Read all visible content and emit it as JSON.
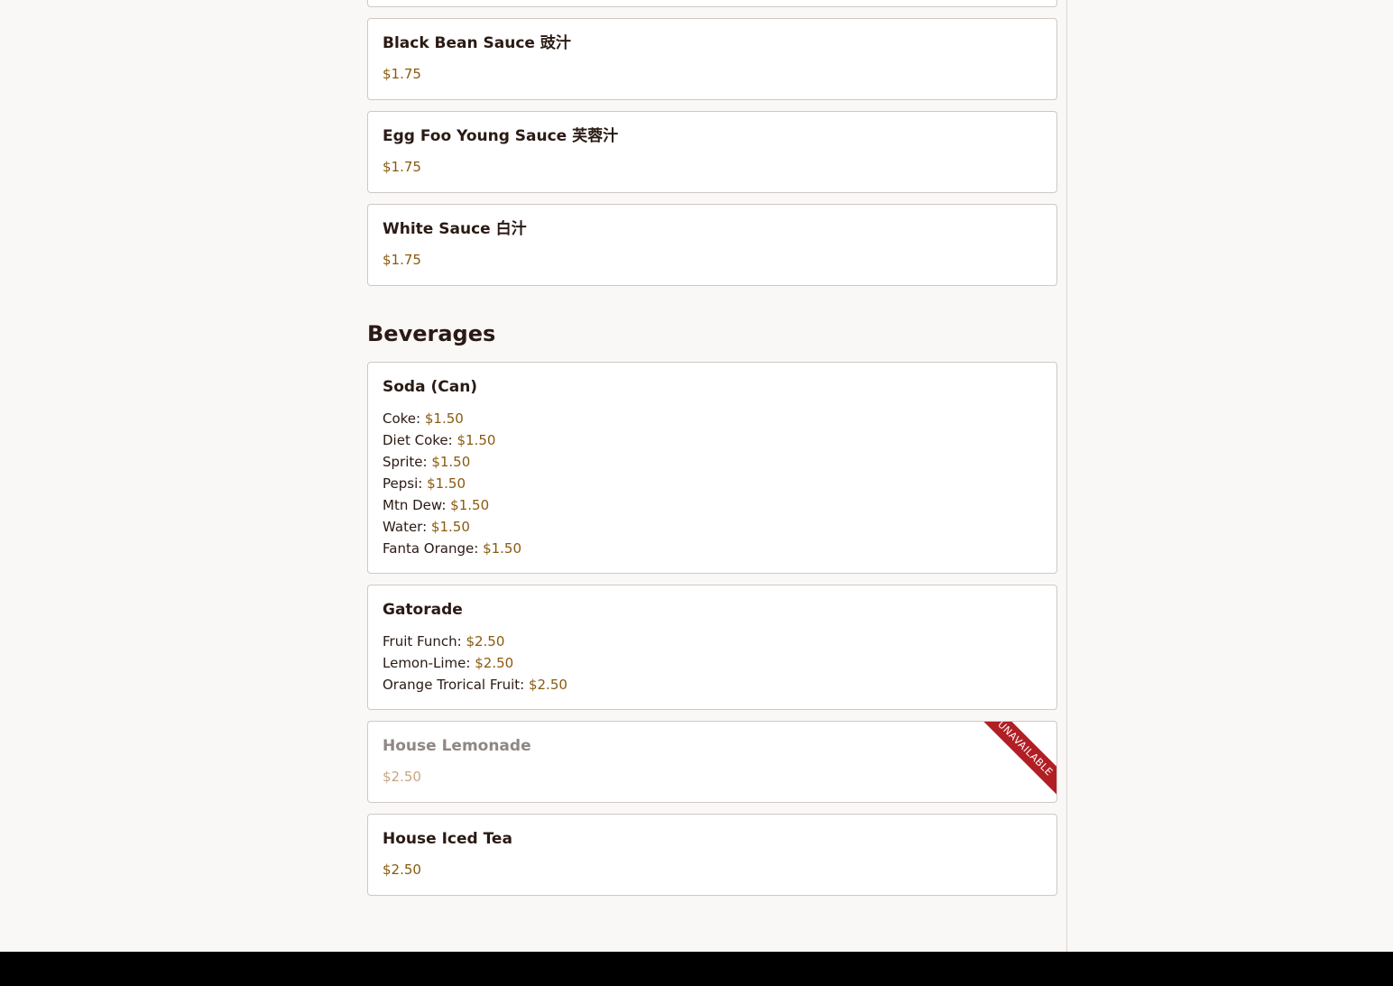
{
  "sauces": [
    {
      "name": "Black Bean Sauce 豉汁",
      "price": "$1.75"
    },
    {
      "name": "Egg Foo Young Sauce 芙蓉汁",
      "price": "$1.75"
    },
    {
      "name": "White Sauce 白汁",
      "price": "$1.75"
    }
  ],
  "beverages": {
    "title": "Beverages",
    "soda": {
      "name": "Soda (Can)",
      "options": [
        {
          "label": "Coke:",
          "price": "$1.50"
        },
        {
          "label": "Diet Coke:",
          "price": "$1.50"
        },
        {
          "label": "Sprite:",
          "price": "$1.50"
        },
        {
          "label": "Pepsi:",
          "price": "$1.50"
        },
        {
          "label": "Mtn Dew:",
          "price": "$1.50"
        },
        {
          "label": "Water:",
          "price": "$1.50"
        },
        {
          "label": "Fanta Orange:",
          "price": "$1.50"
        }
      ]
    },
    "gatorade": {
      "name": "Gatorade",
      "options": [
        {
          "label": "Fruit Funch:",
          "price": "$2.50"
        },
        {
          "label": "Lemon-Lime:",
          "price": "$2.50"
        },
        {
          "label": "Orange Trorical Fruit:",
          "price": "$2.50"
        }
      ]
    },
    "lemonade": {
      "name": "House Lemonade",
      "price": "$2.50",
      "badge": "UNAVAILABLE"
    },
    "iced_tea": {
      "name": "House Iced Tea",
      "price": "$2.50"
    }
  },
  "colors": {
    "price": "#8a5a0f",
    "unavailable_ribbon": "#b11f24",
    "background": "#faf8f6"
  }
}
